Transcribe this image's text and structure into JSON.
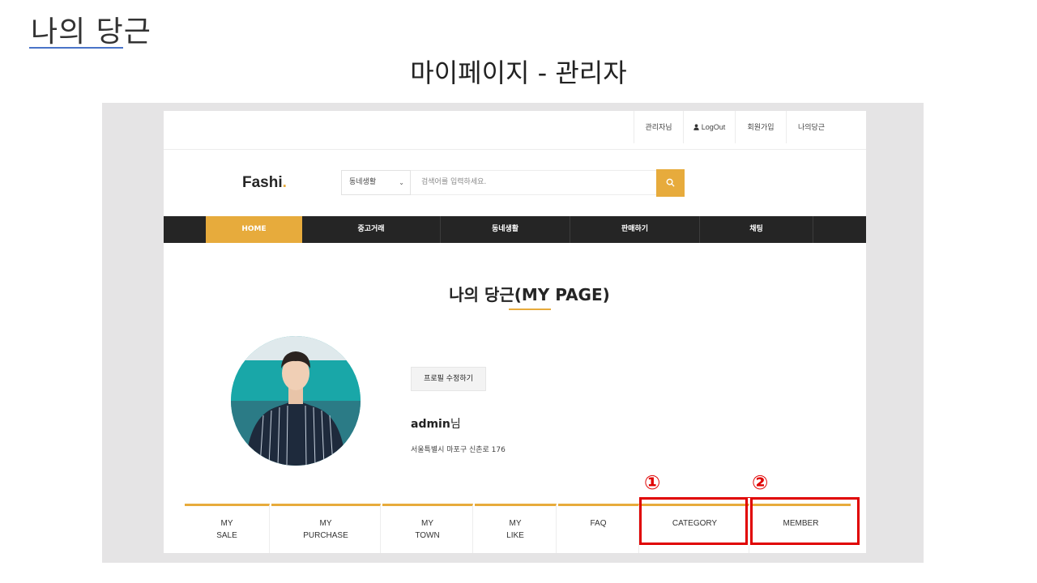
{
  "slide": {
    "title": "나의 당근",
    "subtitle": "마이페이지 - 관리자"
  },
  "topbar": {
    "items": [
      "관리자님",
      "LogOut",
      "회원가입",
      "나의당근"
    ]
  },
  "header": {
    "logo_text": "Fashi",
    "logo_dot": ".",
    "category_select": "동네생활",
    "search_placeholder": "검색어를 입력하세요."
  },
  "nav": {
    "items": [
      "HOME",
      "중고거래",
      "동네생활",
      "판매하기",
      "채팅"
    ],
    "active_index": 0
  },
  "mypage": {
    "title": "나의 당근(MY PAGE)",
    "edit_button": "프로필 수정하기",
    "username": "admin",
    "username_suffix": "님",
    "address": "서울특별시 마포구 신촌로 176"
  },
  "tabs": [
    {
      "line1": "MY",
      "line2": "SALE"
    },
    {
      "line1": "MY",
      "line2": "PURCHASE"
    },
    {
      "line1": "MY",
      "line2": "TOWN"
    },
    {
      "line1": "MY",
      "line2": "LIKE"
    },
    {
      "line1": "FAQ",
      "line2": ""
    },
    {
      "line1": "CATEGORY",
      "line2": ""
    },
    {
      "line1": "MEMBER",
      "line2": ""
    }
  ],
  "annotations": [
    "①",
    "②"
  ],
  "colors": {
    "accent": "#e7ab3c",
    "nav_bg": "#252525",
    "highlight": "#e00000",
    "frame_bg": "#e5e4e5"
  },
  "icons": {
    "user": "user-icon",
    "search": "search-icon",
    "dropdown": "chevron-down-icon"
  }
}
